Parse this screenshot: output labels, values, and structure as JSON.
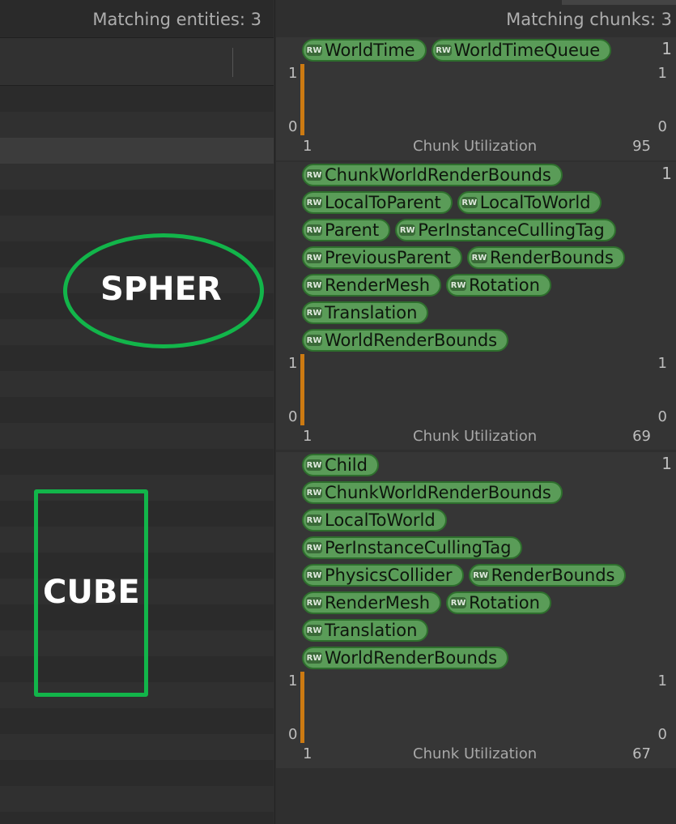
{
  "left_panel": {
    "matching_entities": "Matching entities: 3"
  },
  "right_panel": {
    "matching_chunks": "Matching chunks: 3"
  },
  "annotations": {
    "sphere_label": "SPHER",
    "cube_label": "CUBE",
    "color": "#12b54a"
  },
  "tag_badge": "RW",
  "chunks": [
    {
      "count": "1",
      "tag_lines": [
        [
          "WorldTime",
          "WorldTimeQueue"
        ]
      ],
      "axis_top": "1",
      "axis_bottom": "0",
      "right_top": "1",
      "right_bottom": "0",
      "x_start": "1",
      "label": "Chunk Utilization",
      "x_end": "95"
    },
    {
      "count": "1",
      "tag_lines": [
        [
          "ChunkWorldRenderBounds"
        ],
        [
          "LocalToParent",
          "LocalToWorld"
        ],
        [
          "Parent",
          "PerInstanceCullingTag"
        ],
        [
          "PreviousParent",
          "RenderBounds"
        ],
        [
          "RenderMesh",
          "Rotation"
        ],
        [
          "Translation"
        ],
        [
          "WorldRenderBounds"
        ]
      ],
      "axis_top": "1",
      "axis_bottom": "0",
      "right_top": "1",
      "right_bottom": "0",
      "x_start": "1",
      "label": "Chunk Utilization",
      "x_end": "69"
    },
    {
      "count": "1",
      "tag_lines": [
        [
          "Child"
        ],
        [
          "ChunkWorldRenderBounds"
        ],
        [
          "LocalToWorld"
        ],
        [
          "PerInstanceCullingTag"
        ],
        [
          "PhysicsCollider",
          "RenderBounds"
        ],
        [
          "RenderMesh",
          "Rotation"
        ],
        [
          "Translation"
        ],
        [
          "WorldRenderBounds"
        ]
      ],
      "axis_top": "1",
      "axis_bottom": "0",
      "right_top": "1",
      "right_bottom": "0",
      "x_start": "1",
      "label": "Chunk Utilization",
      "x_end": "67"
    }
  ]
}
